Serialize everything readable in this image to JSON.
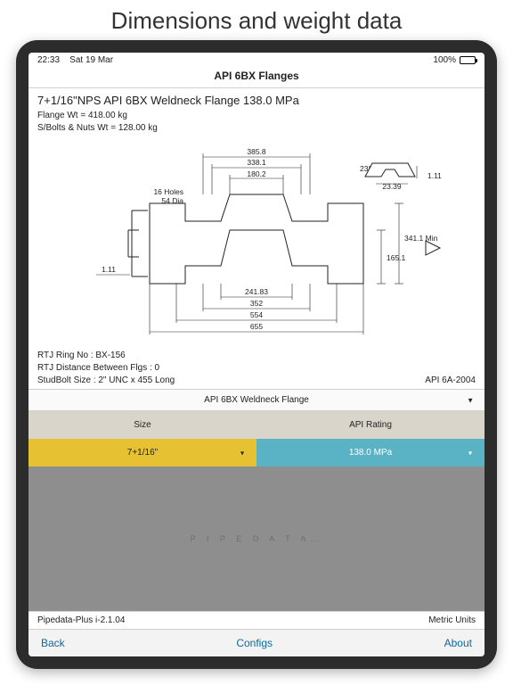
{
  "promo": {
    "headline": "Dimensions and weight data"
  },
  "status": {
    "time": "22:33",
    "date": "Sat 19 Mar",
    "battery": "100%"
  },
  "nav": {
    "title": "API 6BX Flanges"
  },
  "main": {
    "heading": "7+1/16\"NPS API 6BX Weldneck Flange 138.0 MPa",
    "flange_wt": "Flange Wt = 418.00 kg",
    "bolts_wt": "S/Bolts & Nuts Wt =  128.00 kg"
  },
  "dims": {
    "top1": "385.8",
    "top2": "338.1",
    "top3": "180.2",
    "holes": "16 Holes",
    "holes_dia": "54 Dia",
    "right_angle": "23°",
    "right_small": "1.11",
    "right_width": "23.39",
    "right_h1": "341.1 Min",
    "right_h2": "165.1",
    "left_small": "1.11",
    "bot1": "241.83",
    "bot2": "352",
    "bot3": "554",
    "bot4": "655"
  },
  "footnotes": {
    "ring": "RTJ Ring No : BX-156",
    "dist": "RTJ Distance Between Flgs : 0"
  },
  "spec": {
    "stud": "StudBolt Size : 2\" UNC x 455 Long",
    "std": "API 6A-2004"
  },
  "type_select": {
    "label": "API 6BX Weldneck Flange"
  },
  "picker": {
    "size_label": "Size",
    "rating_label": "API Rating",
    "size_value": "7+1/16\"",
    "rating_value": "138.0 MPa"
  },
  "watermark": "P I P E D A T A…",
  "bottom": {
    "version": "Pipedata-Plus i-2.1.04",
    "units": "Metric Units"
  },
  "toolbar": {
    "back": "Back",
    "configs": "Configs",
    "about": "About"
  }
}
